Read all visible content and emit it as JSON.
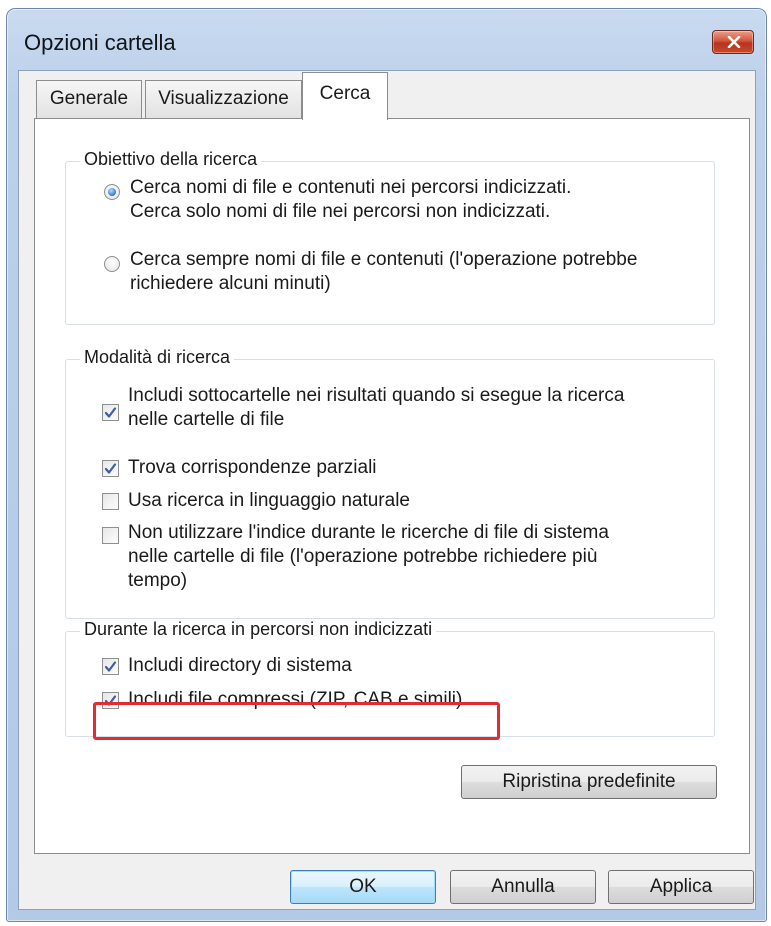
{
  "window": {
    "title": "Opzioni cartella"
  },
  "tabs": [
    {
      "label": "Generale",
      "active": false
    },
    {
      "label": "Visualizzazione",
      "active": false
    },
    {
      "label": "Cerca",
      "active": true
    }
  ],
  "groups": {
    "target": {
      "label": "Obiettivo della ricerca",
      "options": [
        {
          "text1": "Cerca nomi di file e contenuti nei percorsi indicizzati.",
          "text2": "Cerca solo nomi di file nei percorsi non indicizzati.",
          "selected": true
        },
        {
          "text1": "Cerca sempre nomi di file e contenuti (l'operazione potrebbe",
          "text2": "richiedere alcuni minuti)",
          "selected": false
        }
      ]
    },
    "mode": {
      "label": "Modalità di ricerca",
      "options": [
        {
          "text1": "Includi sottocartelle nei risultati quando si esegue la ricerca",
          "text2": "nelle cartelle di file",
          "checked": true
        },
        {
          "text1": "Trova corrispondenze parziali",
          "checked": true
        },
        {
          "text1": "Usa ricerca in linguaggio naturale",
          "checked": false
        },
        {
          "text1": "Non utilizzare l'indice durante le ricerche di file di sistema",
          "text2": "nelle cartelle di file (l'operazione potrebbe richiedere più",
          "text3": "tempo)",
          "checked": false
        }
      ]
    },
    "nonindexed": {
      "label": "Durante la ricerca in percorsi non indicizzati",
      "options": [
        {
          "text1": "Includi directory di sistema",
          "checked": true
        },
        {
          "text1": "Includi file compressi (ZIP, CAB e simili)",
          "checked": true
        }
      ]
    }
  },
  "buttons": {
    "restore": "Ripristina predefinite",
    "ok": "OK",
    "cancel": "Annulla",
    "apply": "Applica"
  },
  "colors": {
    "highlight": "#e32b35",
    "accent": "#2e78c8"
  },
  "icons": {
    "close": "close-icon",
    "check": "checkmark-icon",
    "radio": "radio-dot-icon"
  }
}
